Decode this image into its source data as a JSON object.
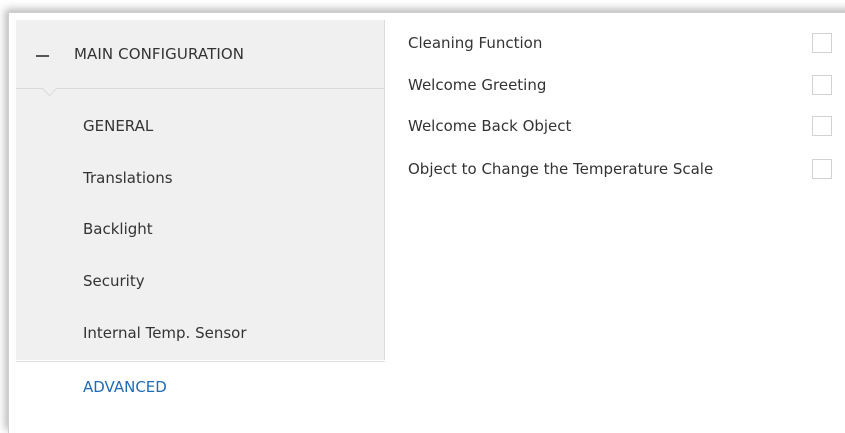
{
  "sidebar": {
    "section": {
      "title": "MAIN CONFIGURATION",
      "state_icon": "minus-icon"
    },
    "items": [
      {
        "label": "GENERAL",
        "active": false
      },
      {
        "label": "Translations",
        "active": false
      },
      {
        "label": "Backlight",
        "active": false
      },
      {
        "label": "Security",
        "active": false
      },
      {
        "label": "Internal Temp. Sensor",
        "active": false
      },
      {
        "label": "ADVANCED",
        "active": true
      }
    ]
  },
  "panel": {
    "params": [
      {
        "label": "Cleaning Function",
        "checked": false
      },
      {
        "label": "Welcome Greeting",
        "checked": false
      },
      {
        "label": "Welcome Back Object",
        "checked": false
      },
      {
        "label": "Object to Change the Temperature Scale",
        "checked": false
      }
    ]
  },
  "colors": {
    "sidebar_bg": "#f0f0f0",
    "active_text": "#1f6bb4",
    "text": "#333333"
  }
}
